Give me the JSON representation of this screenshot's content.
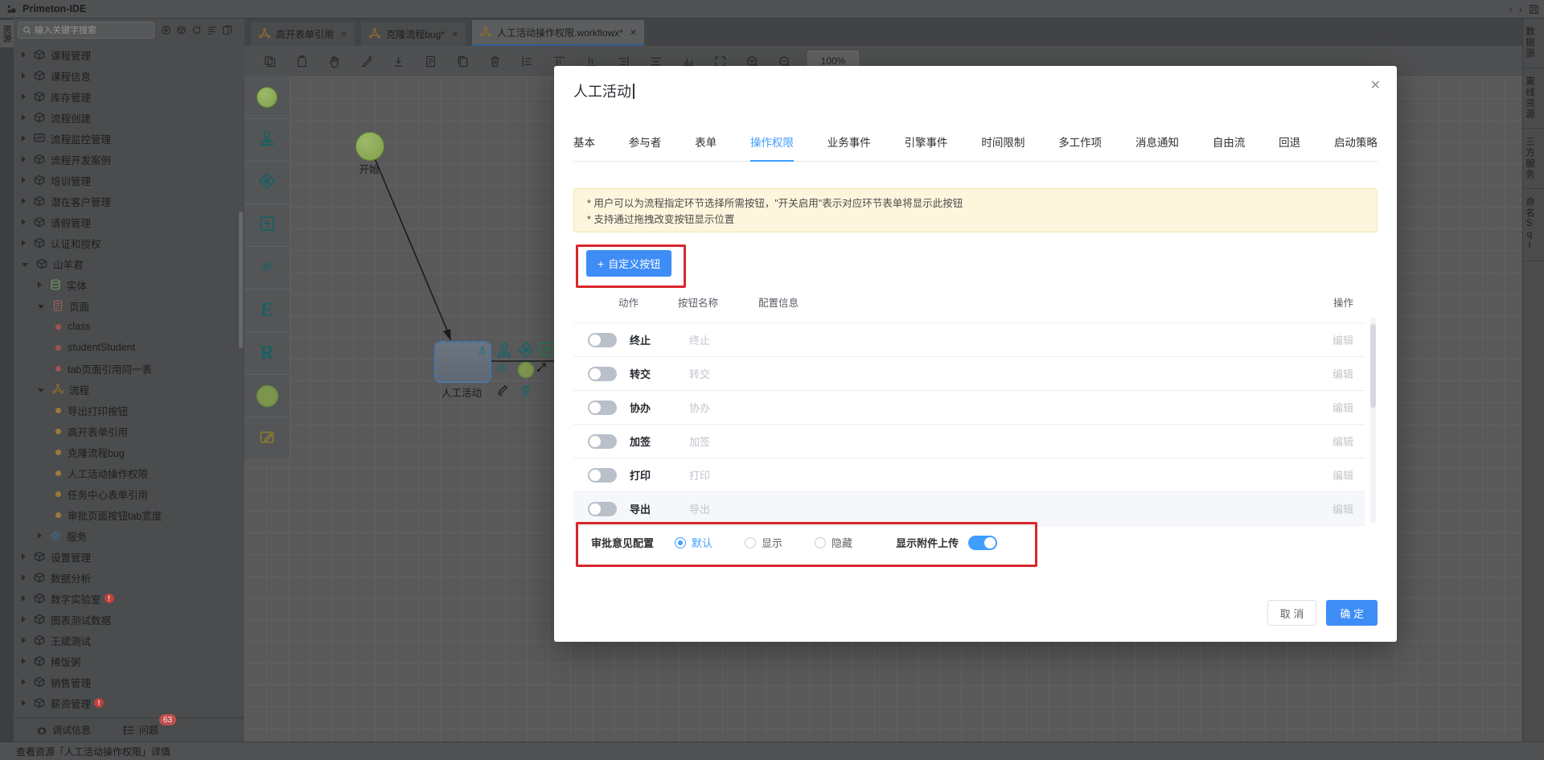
{
  "app": {
    "title": "Primeton-IDE"
  },
  "left_rail": {
    "tab": "资源"
  },
  "sidebar": {
    "search_placeholder": "输入关键字搜索",
    "search_icons": [
      "ai-icon",
      "cube-icon",
      "refresh-icon",
      "outline-icon",
      "docs-icon"
    ],
    "tree": [
      {
        "level": 0,
        "expander": "collapsed",
        "icon": "package",
        "label": "课程管理"
      },
      {
        "level": 0,
        "expander": "collapsed",
        "icon": "package",
        "label": "课程信息"
      },
      {
        "level": 0,
        "expander": "collapsed",
        "icon": "package",
        "label": "库存管理"
      },
      {
        "level": 0,
        "expander": "collapsed",
        "icon": "package",
        "label": "流程创建"
      },
      {
        "level": 0,
        "expander": "collapsed",
        "icon": "monitor",
        "label": "流程监控管理"
      },
      {
        "level": 0,
        "expander": "collapsed",
        "icon": "package",
        "label": "流程开发案例"
      },
      {
        "level": 0,
        "expander": "collapsed",
        "icon": "package",
        "label": "培训管理"
      },
      {
        "level": 0,
        "expander": "collapsed",
        "icon": "package",
        "label": "潜在客户管理"
      },
      {
        "level": 0,
        "expander": "collapsed",
        "icon": "package",
        "label": "请假管理"
      },
      {
        "level": 0,
        "expander": "collapsed",
        "icon": "package",
        "label": "认证和授权"
      },
      {
        "level": 0,
        "expander": "expanded",
        "icon": "package",
        "label": "山羊君"
      },
      {
        "level": 1,
        "expander": "collapsed",
        "icon": "db",
        "label": "实体"
      },
      {
        "level": 1,
        "expander": "expanded",
        "icon": "page",
        "label": "页面"
      },
      {
        "level": 2,
        "dot": "red",
        "label": "class"
      },
      {
        "level": 2,
        "dot": "red",
        "label": "studentStudent"
      },
      {
        "level": 2,
        "dot": "red",
        "label": "tab页面引用同一表"
      },
      {
        "level": 1,
        "expander": "expanded",
        "icon": "flow",
        "label": "流程"
      },
      {
        "level": 2,
        "dot": "orange",
        "label": "导出打印按钮"
      },
      {
        "level": 2,
        "dot": "orange",
        "label": "高开表单引用"
      },
      {
        "level": 2,
        "dot": "orange",
        "label": "克隆流程bug"
      },
      {
        "level": 2,
        "dot": "orange",
        "label": "人工活动操作权限"
      },
      {
        "level": 2,
        "dot": "orange",
        "label": "任务中心表单引用"
      },
      {
        "level": 2,
        "dot": "orange",
        "label": "审批页面按钮tab宽度"
      },
      {
        "level": 1,
        "expander": "collapsed",
        "icon": "gear",
        "label": "服务"
      },
      {
        "level": 0,
        "expander": "collapsed",
        "icon": "package",
        "label": "设置管理"
      },
      {
        "level": 0,
        "expander": "collapsed",
        "icon": "package",
        "label": "数据分析"
      },
      {
        "level": 0,
        "expander": "collapsed",
        "icon": "package",
        "label": "数字实验室",
        "badge": "!"
      },
      {
        "level": 0,
        "expander": "collapsed",
        "icon": "package",
        "label": "图表测试数据"
      },
      {
        "level": 0,
        "expander": "collapsed",
        "icon": "package",
        "label": "王斌测试"
      },
      {
        "level": 0,
        "expander": "collapsed",
        "icon": "package",
        "label": "稀饭粥"
      },
      {
        "level": 0,
        "expander": "collapsed",
        "icon": "package",
        "label": "销售管理"
      },
      {
        "level": 0,
        "expander": "collapsed",
        "icon": "package",
        "label": "薪资管理",
        "badge": "!"
      }
    ],
    "bottom": {
      "debug": "调试信息",
      "problems": "问题",
      "problems_count": "63"
    }
  },
  "statusbar": {
    "text": "查看资源「人工活动操作权限」详情"
  },
  "editor": {
    "tabs": [
      {
        "label": "高开表单引用",
        "active": false
      },
      {
        "label": "克隆流程bug*",
        "active": false
      },
      {
        "label": "人工活动操作权限.workflowx*",
        "active": true
      }
    ],
    "toolbar_icons": [
      "copy-icon",
      "clipboard-icon",
      "hand-icon",
      "brush-icon",
      "download-icon",
      "document-icon",
      "document-copy-icon",
      "trash-icon",
      "align-left-icon",
      "align-top-icon",
      "align-bottom-icon",
      "align-right-icon",
      "align-center-icon",
      "bar-chart-icon",
      "fit-screen-icon",
      "zoom-in-icon",
      "zoom-out-icon"
    ],
    "zoom_level": "100%",
    "palette": [
      "start-circle",
      "participant",
      "gateway-diamond",
      "subflow-plus",
      "service-gear",
      "glyph-E",
      "glyph-R",
      "end-circle",
      "note-edit"
    ],
    "canvas": {
      "start_label": "开始",
      "task_label": "人工活动"
    }
  },
  "right_panel": {
    "tabs": [
      "数据源",
      "离线资源",
      "三方服务",
      "命名Sql"
    ]
  },
  "modal": {
    "title": "人工活动",
    "close": "✕",
    "tabs": [
      "基本",
      "参与者",
      "表单",
      "操作权限",
      "业务事件",
      "引擎事件",
      "时间限制",
      "多工作项",
      "消息通知",
      "自由流",
      "回退",
      "启动策略"
    ],
    "active_tab": "操作权限",
    "notice_lines": [
      "* 用户可以为流程指定环节选择所需按钮，\"开关启用\"表示对应环节表单将显示此按钮",
      "* 支持通过拖拽改变按钮显示位置"
    ],
    "custom_button": "自定义按钮",
    "table": {
      "headers": [
        "动作",
        "按钮名称",
        "配置信息",
        "操作"
      ],
      "rows": [
        {
          "action": "终止",
          "name": "终止",
          "enabled": false,
          "edit": "编辑"
        },
        {
          "action": "转交",
          "name": "转交",
          "enabled": false,
          "edit": "编辑"
        },
        {
          "action": "协办",
          "name": "协办",
          "enabled": false,
          "edit": "编辑"
        },
        {
          "action": "加签",
          "name": "加签",
          "enabled": false,
          "edit": "编辑"
        },
        {
          "action": "打印",
          "name": "打印",
          "enabled": false,
          "edit": "编辑"
        },
        {
          "action": "导出",
          "name": "导出",
          "enabled": false,
          "edit": "编辑"
        }
      ]
    },
    "opinion": {
      "label": "审批意见配置",
      "options": [
        "默认",
        "显示",
        "隐藏"
      ],
      "selected": "默认",
      "attachment_label": "显示附件上传",
      "attachment_on": true
    },
    "footer": {
      "cancel": "取 消",
      "ok": "确 定"
    },
    "accent_color": "#409eff",
    "annotation_color": "#d9262c"
  }
}
